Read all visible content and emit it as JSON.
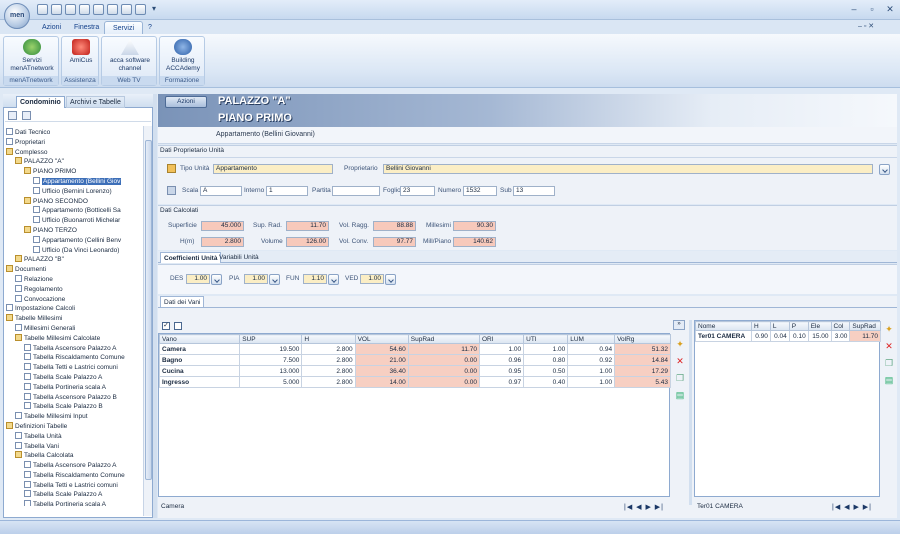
{
  "ribbon": {
    "tabs": [
      "Azioni",
      "Finestra",
      "Servizi",
      "?"
    ],
    "active_tab": "Servizi",
    "groups": [
      {
        "label": "menATnetwork",
        "buttons": [
          "Servizi menATnetwork"
        ]
      },
      {
        "label": "Assistenza",
        "buttons": [
          "AmiCus"
        ]
      },
      {
        "label": "Web TV",
        "buttons": [
          "acca software channel"
        ]
      },
      {
        "label": "Formazione",
        "buttons": [
          "Building ACCAdemy"
        ]
      }
    ]
  },
  "left": {
    "tab_active": "Condominio",
    "tab_other": "Archivi e Tabelle",
    "tree": [
      {
        "label": "Dati Tecnico",
        "level": 0,
        "icon": "doc"
      },
      {
        "label": "Proprietari",
        "level": 0,
        "icon": "doc"
      },
      {
        "label": "Complesso",
        "level": 0,
        "icon": "folder"
      },
      {
        "label": "PALAZZO \"A\"",
        "level": 1,
        "icon": "folder"
      },
      {
        "label": "PIANO PRIMO",
        "level": 2,
        "icon": "folder"
      },
      {
        "label": "Appartamento (Bellini Giov",
        "level": 3,
        "icon": "doc",
        "selected": true
      },
      {
        "label": "Ufficio (Bernini Lorenzo)",
        "level": 3,
        "icon": "doc"
      },
      {
        "label": "PIANO SECONDO",
        "level": 2,
        "icon": "folder"
      },
      {
        "label": "Appartamento (Botticelli Sa",
        "level": 3,
        "icon": "doc"
      },
      {
        "label": "Ufficio (Buonarroti Michelar",
        "level": 3,
        "icon": "doc"
      },
      {
        "label": "PIANO TERZO",
        "level": 2,
        "icon": "folder"
      },
      {
        "label": "Appartamento (Cellini Benv",
        "level": 3,
        "icon": "doc"
      },
      {
        "label": "Ufficio (Da Vinci Leonardo)",
        "level": 3,
        "icon": "doc"
      },
      {
        "label": "PALAZZO \"B\"",
        "level": 1,
        "icon": "folder"
      },
      {
        "label": "Documenti",
        "level": 0,
        "icon": "folder"
      },
      {
        "label": "Relazione",
        "level": 1,
        "icon": "doc"
      },
      {
        "label": "Regolamento",
        "level": 1,
        "icon": "doc"
      },
      {
        "label": "Convocazione",
        "level": 1,
        "icon": "doc"
      },
      {
        "label": "Impostazione Calcoli",
        "level": 0,
        "icon": "doc"
      },
      {
        "label": "Tabelle Millesimi",
        "level": 0,
        "icon": "folder"
      },
      {
        "label": "Millesimi Generali",
        "level": 1,
        "icon": "doc"
      },
      {
        "label": "Tabelle Millesimi Calcolate",
        "level": 1,
        "icon": "folder"
      },
      {
        "label": "Tabella Ascensore Palazzo A",
        "level": 2,
        "icon": "doc"
      },
      {
        "label": "Tabella Riscaldamento Comune",
        "level": 2,
        "icon": "doc"
      },
      {
        "label": "Tabella Tetti e Lastrici comuni",
        "level": 2,
        "icon": "doc"
      },
      {
        "label": "Tabella Scale Palazzo A",
        "level": 2,
        "icon": "doc"
      },
      {
        "label": "Tabella Portineria scala A",
        "level": 2,
        "icon": "doc"
      },
      {
        "label": "Tabella Ascensore Palazzo B",
        "level": 2,
        "icon": "doc"
      },
      {
        "label": "Tabella Scale Palazzo B",
        "level": 2,
        "icon": "doc"
      },
      {
        "label": "Tabelle Millesimi Input",
        "level": 1,
        "icon": "doc"
      },
      {
        "label": "Definizioni Tabelle",
        "level": 0,
        "icon": "folder"
      },
      {
        "label": "Tabella Unità",
        "level": 1,
        "icon": "doc"
      },
      {
        "label": "Tabella Vani",
        "level": 1,
        "icon": "doc"
      },
      {
        "label": "Tabella Calcolata",
        "level": 1,
        "icon": "folder"
      },
      {
        "label": "Tabella Ascensore Palazzo A",
        "level": 2,
        "icon": "doc"
      },
      {
        "label": "Tabella Riscaldamento Comune",
        "level": 2,
        "icon": "doc"
      },
      {
        "label": "Tabella Tetti e Lastrici comuni",
        "level": 2,
        "icon": "doc"
      },
      {
        "label": "Tabella Scale Palazzo A",
        "level": 2,
        "icon": "doc"
      },
      {
        "label": "Tabella Portineria scala A",
        "level": 2,
        "icon": "doc"
      }
    ]
  },
  "header": {
    "azioni_label": "Azioni",
    "line1": "PALAZZO \"A\"",
    "line2": "PIANO PRIMO",
    "line3": "Appartamento (Bellini Giovanni)"
  },
  "proprietario": {
    "section_title": "Dati Proprietario Unità",
    "tipo_label": "Tipo Unità",
    "tipo_value": "Appartamento",
    "prop_label": "Proprietario",
    "prop_value": "Bellini Giovanni",
    "scala_label": "Scala",
    "scala_value": "A",
    "interno_label": "Interno",
    "interno_value": "1",
    "partita_label": "Partita",
    "partita_value": "",
    "foglio_label": "Foglio",
    "foglio_value": "23",
    "numero_label": "Numero",
    "numero_value": "1532",
    "sub_label": "Sub",
    "sub_value": "13"
  },
  "calcolati": {
    "section_title": "Dati Calcolati",
    "superficie_label": "Superficie",
    "superficie": "45.000",
    "suprad_label": "Sup. Rad.",
    "suprad": "11.70",
    "volragg_label": "Vol. Ragg.",
    "volragg": "88.88",
    "millesimi_label": "Millesimi",
    "millesimi": "90.30",
    "h_label": "H(m)",
    "h": "2.800",
    "volume_label": "Volume",
    "volume": "126.00",
    "volconv_label": "Vol. Conv.",
    "volconv": "97.77",
    "millpiano_label": "Mill/Piano",
    "millpiano": "140.62"
  },
  "coeff": {
    "tab_active": "Coefficienti Unità",
    "tab_other": "Variabili Unità",
    "items": [
      {
        "label": "DES",
        "value": "1.00"
      },
      {
        "label": "PIA",
        "value": "1.00"
      },
      {
        "label": "FUN",
        "value": "1.10"
      },
      {
        "label": "VED",
        "value": "1.00"
      }
    ]
  },
  "vani": {
    "section_tab": "Dati dei Vani",
    "columns": [
      "Vano",
      "SUP",
      "H",
      "VOL",
      "SupRad",
      "ORI",
      "UTI",
      "LUM",
      "VolRg"
    ],
    "rows": [
      [
        "Camera",
        "19.500",
        "2.800",
        "54.60",
        "11.70",
        "1.00",
        "1.00",
        "0.94",
        "51.32"
      ],
      [
        "Bagno",
        "7.500",
        "2.800",
        "21.00",
        "0.00",
        "0.96",
        "0.80",
        "0.92",
        "14.84"
      ],
      [
        "Cucina",
        "13.000",
        "2.800",
        "36.40",
        "0.00",
        "0.95",
        "0.50",
        "1.00",
        "17.29"
      ],
      [
        "Ingresso",
        "5.000",
        "2.800",
        "14.00",
        "0.00",
        "0.97",
        "0.40",
        "1.00",
        "5.43"
      ]
    ],
    "footer_label": "Camera"
  },
  "radiatori": {
    "columns": [
      "Nome",
      "H",
      "L",
      "P",
      "Ele",
      "Col",
      "SupRad"
    ],
    "rows": [
      [
        "Ter01 CAMERA",
        "0.90",
        "0.04",
        "0.10",
        "15.00",
        "3.00",
        "11.70"
      ]
    ],
    "footer_label": "Ter01 CAMERA"
  },
  "nav_glyphs": "|◀ ◀ ▶ ▶|",
  "colors": {
    "accent": "#3d6fb8",
    "calc": "#f7c9bb",
    "input": "#fbeec5"
  }
}
